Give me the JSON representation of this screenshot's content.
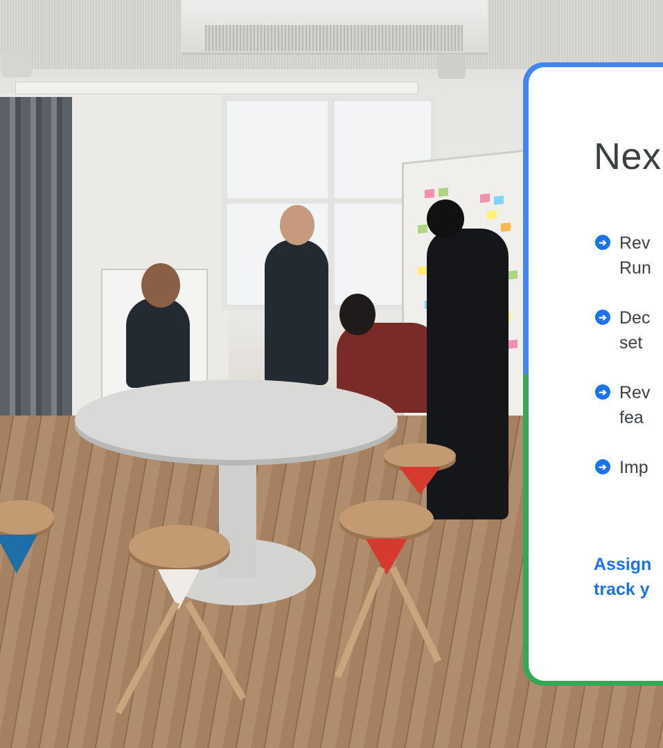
{
  "card": {
    "title": "Nex",
    "items": [
      {
        "icon": "arrow-right-circle-icon",
        "text": "Rev\nRun"
      },
      {
        "icon": "arrow-right-circle-icon",
        "text": "Dec\nset"
      },
      {
        "icon": "arrow-right-circle-icon",
        "text": "Rev\nfea"
      },
      {
        "icon": "arrow-right-circle-icon",
        "text": "Imp"
      }
    ],
    "assign_text": "Assign\ntrack y",
    "colors": {
      "border_top": "#4285f4",
      "border_bottom": "#34a853",
      "accent": "#1a73e8",
      "text": "#3c4043"
    }
  },
  "icon_glyph": "➔"
}
